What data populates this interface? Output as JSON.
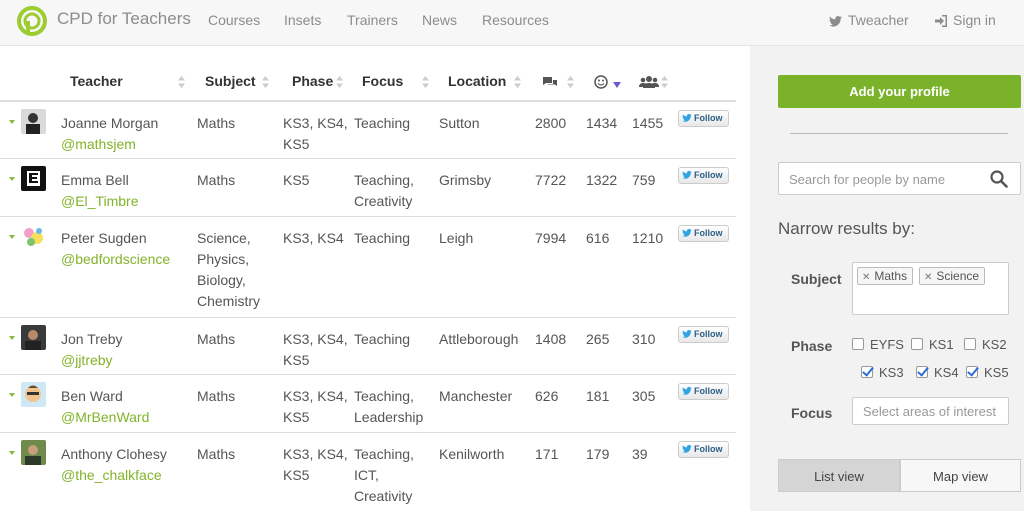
{
  "brand": {
    "name": "CPD for Teachers"
  },
  "nav": [
    "Courses",
    "Insets",
    "Trainers",
    "News",
    "Resources"
  ],
  "top_right": {
    "twitter_label": "Tweacher",
    "signin_label": "Sign in"
  },
  "table": {
    "headers": {
      "teacher": "Teacher",
      "subject": "Subject",
      "phase": "Phase",
      "focus": "Focus",
      "location": "Location"
    },
    "icons": {
      "col1": "comments-icon",
      "col2": "smiley-icon",
      "col3": "group-icon"
    },
    "follow_label": "Follow",
    "rows": [
      {
        "name": "Joanne Morgan",
        "handle": "@mathsjem",
        "subject": [
          "Maths"
        ],
        "phase": [
          "KS3, KS4,",
          "KS5"
        ],
        "focus": [
          "Teaching"
        ],
        "location": "Sutton",
        "n1": "2800",
        "n2": "1434",
        "n3": "1455"
      },
      {
        "name": "Emma Bell",
        "handle": "@El_Timbre",
        "subject": [
          "Maths"
        ],
        "phase": [
          "KS5"
        ],
        "focus": [
          "Teaching,",
          "Creativity"
        ],
        "location": "Grimsby",
        "n1": "7722",
        "n2": "1322",
        "n3": "759"
      },
      {
        "name": "Peter Sugden",
        "handle": "@bedfordscience",
        "subject": [
          "Science,",
          "Physics,",
          "Biology,",
          "Chemistry"
        ],
        "phase": [
          "KS3, KS4"
        ],
        "focus": [
          "Teaching"
        ],
        "location": "Leigh",
        "n1": "7994",
        "n2": "616",
        "n3": "1210"
      },
      {
        "name": "Jon Treby",
        "handle": "@jjtreby",
        "subject": [
          "Maths"
        ],
        "phase": [
          "KS3, KS4,",
          "KS5"
        ],
        "focus": [
          "Teaching"
        ],
        "location": "Attleborough",
        "n1": "1408",
        "n2": "265",
        "n3": "310"
      },
      {
        "name": "Ben Ward",
        "handle": "@MrBenWard",
        "subject": [
          "Maths"
        ],
        "phase": [
          "KS3, KS4,",
          "KS5"
        ],
        "focus": [
          "Teaching,",
          "Leadership"
        ],
        "location": "Manchester",
        "n1": "626",
        "n2": "181",
        "n3": "305"
      },
      {
        "name": "Anthony Clohesy",
        "handle": "@the_chalkface",
        "subject": [
          "Maths"
        ],
        "phase": [
          "KS3, KS4,",
          "KS5"
        ],
        "focus": [
          "Teaching,",
          "ICT,",
          "Creativity"
        ],
        "location": "Kenilworth",
        "n1": "171",
        "n2": "179",
        "n3": "39"
      }
    ]
  },
  "sidebar": {
    "add_profile": "Add your profile",
    "search_placeholder": "Search for people by name",
    "narrow_title": "Narrow results by:",
    "subject_label": "Subject",
    "subject_tags": [
      "Maths",
      "Science"
    ],
    "phase_label": "Phase",
    "phases": [
      {
        "label": "EYFS",
        "checked": false
      },
      {
        "label": "KS1",
        "checked": false
      },
      {
        "label": "KS2",
        "checked": false
      },
      {
        "label": "KS3",
        "checked": true
      },
      {
        "label": "KS4",
        "checked": true
      },
      {
        "label": "KS5",
        "checked": true
      }
    ],
    "focus_label": "Focus",
    "focus_placeholder": "Select areas of interest",
    "list_view": "List view",
    "map_view": "Map view"
  },
  "colors": {
    "accent": "#7ab22a",
    "link_green": "#82b42a",
    "checkbox_blue": "#2a6ed6"
  }
}
